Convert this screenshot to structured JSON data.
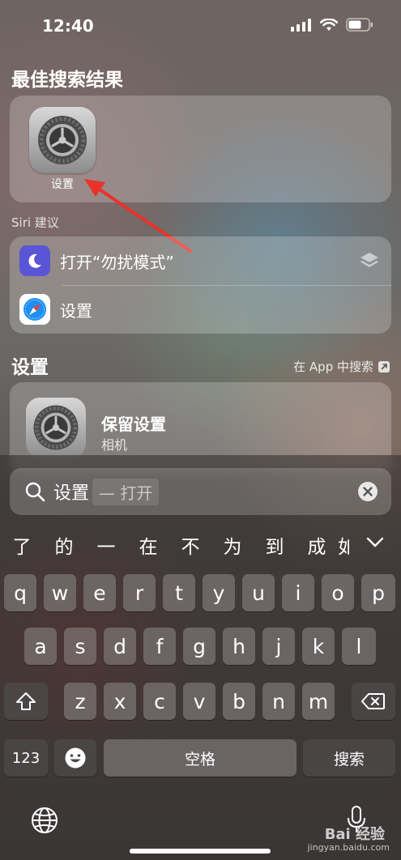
{
  "status": {
    "time": "12:40"
  },
  "top_hits": {
    "title": "最佳搜索结果",
    "app_label": "设置"
  },
  "siri": {
    "title": "Siri 建议",
    "items": [
      {
        "label": "打开“勿扰模式”",
        "icon": "moon-icon"
      },
      {
        "label": "设置",
        "icon": "safari-icon"
      }
    ]
  },
  "settings_section": {
    "title": "设置",
    "search_in_app": "在 App 中搜索",
    "item_title": "保留设置",
    "item_subtitle": "相机"
  },
  "search": {
    "value": "设置",
    "completion": "— 打开"
  },
  "candidates": [
    "了",
    "的",
    "一",
    "在",
    "不",
    "为",
    "到",
    "成",
    "如"
  ],
  "keyboard": {
    "row1": [
      "q",
      "w",
      "e",
      "r",
      "t",
      "y",
      "u",
      "i",
      "o",
      "p"
    ],
    "row2": [
      "a",
      "s",
      "d",
      "f",
      "g",
      "h",
      "j",
      "k",
      "l"
    ],
    "row3": [
      "z",
      "x",
      "c",
      "v",
      "b",
      "n",
      "m"
    ],
    "numbers_key": "123",
    "space_key": "空格",
    "search_key": "搜索"
  },
  "watermark": {
    "brand": "Bai 经验",
    "url": "jingyan.baidu.com"
  },
  "colors": {
    "accent_red": "#e8332a",
    "dnd_purple": "#5a55d6"
  }
}
